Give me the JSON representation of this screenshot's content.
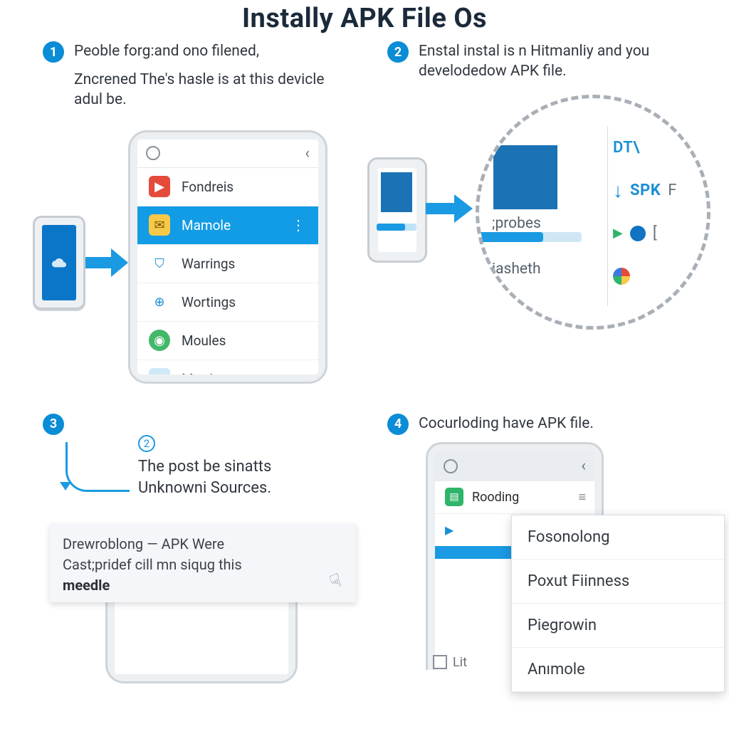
{
  "title": "Instally APK File Os",
  "steps": {
    "s1": {
      "num": "1",
      "line1": "Peoble forg:and ono filened,",
      "line2": "Zncrened The's hasle is at this devicle adul be."
    },
    "s2": {
      "num": "2",
      "line1": "Enstal instal is n Hitmanliy and you develodedow APK file."
    },
    "s3": {
      "num": "3",
      "mini_num": "2",
      "line1": "The post be sinatts",
      "line2": "Unknowni Sources.",
      "card_l1": "Drewroblong — APK Were",
      "card_l2": "Cast;pridef cill mn siqug this",
      "card_strong": "meedle"
    },
    "s4": {
      "num": "4",
      "line1": "Cocurloding have APK file."
    }
  },
  "phone1": {
    "items": [
      {
        "icon": "red",
        "label": "Fondreis"
      },
      {
        "icon": "yel",
        "label": "Mamole",
        "active": true
      },
      {
        "icon": "blu",
        "label": "Warrings"
      },
      {
        "icon": "bluC",
        "label": "Wortings"
      },
      {
        "icon": "grnC",
        "label": "Moules"
      },
      {
        "icon": "ltblu",
        "label": "Metrios"
      }
    ]
  },
  "zoom": {
    "left_labels": {
      "a": ";probes",
      "b": "iasheth"
    },
    "right": {
      "dt": "DT\\",
      "spk": "SPK",
      "f": "F",
      "tri_extra": "["
    }
  },
  "menu4": {
    "header": "Rooding",
    "items": [
      "Fosonolong",
      "Poxut Fiinness",
      "Piegrowin",
      "Anımole"
    ],
    "footer": "Lit"
  }
}
